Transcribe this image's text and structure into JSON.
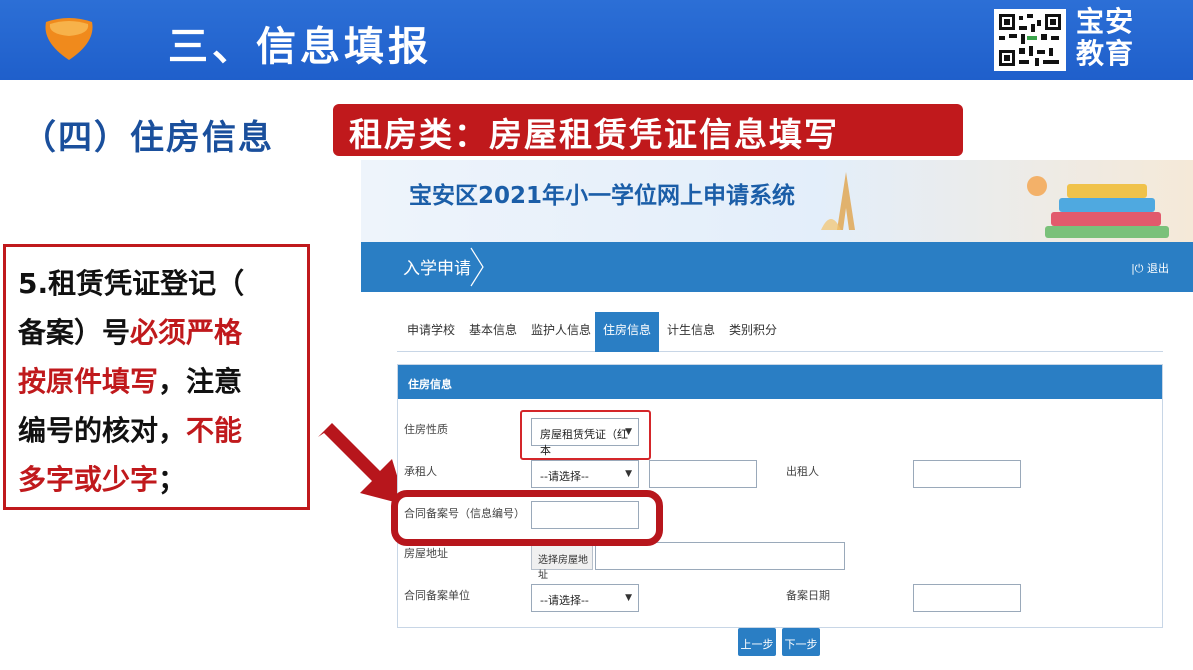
{
  "header": {
    "title": "三、信息填报",
    "brand_line1": "宝安",
    "brand_line2": "教育"
  },
  "section": {
    "title": "（四）住房信息",
    "banner": "租房类：房屋租赁凭证信息填写"
  },
  "note": {
    "line1": "5.租赁凭证登记（",
    "line2_a": "备案）号",
    "line2_b": "必须严格",
    "line3_a": "按原件填写",
    "line3_b": "，注意",
    "line4_a": "编号的核对，",
    "line4_b": "不能",
    "line5_a": "多字或少字",
    "line5_b": "；"
  },
  "app": {
    "system_title": "宝安区2021年小一学位网上申请系统",
    "nav_tab": "入学申请",
    "logout": "退出",
    "tabs": [
      "申请学校",
      "基本信息",
      "监护人信息",
      "住房信息",
      "计生信息",
      "类别积分"
    ],
    "panel_title": "住房信息",
    "form": {
      "housing_type_label": "住房性质",
      "housing_type_value": "房屋租赁凭证（红本",
      "lessee_label": "承租人",
      "lessee_select": "--请选择--",
      "lessor_label": "出租人",
      "contract_no_label": "合同备案号（信息编号）",
      "address_label": "房屋地址",
      "address_button": "选择房屋地址",
      "filing_unit_label": "合同备案单位",
      "filing_unit_select": "--请选择--",
      "filing_date_label": "备案日期"
    },
    "prev_button": "上一步",
    "next_button": "下一步"
  },
  "colors": {
    "header_blue": "#1f5fcb",
    "accent_red": "#c0191c",
    "app_blue": "#2a7ec4",
    "title_blue": "#1a4f9c"
  }
}
